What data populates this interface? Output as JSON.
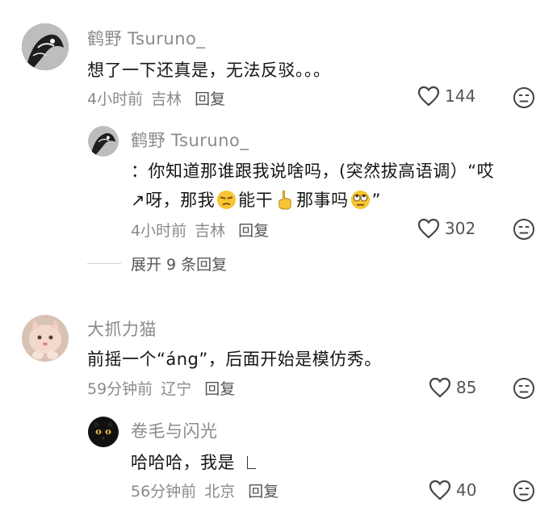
{
  "comments": [
    {
      "user": "鹤野 Tsuruno_",
      "text": "想了一下还真是，无法反驳。。。",
      "time": "4小时前",
      "location": "吉林",
      "reply_label": "回复",
      "likes": "144",
      "replies": [
        {
          "user": "鹤野 Tsuruno_",
          "text_line1": "：你知道那谁跟我说啥吗，(突然拔高语调）“哎",
          "text_line2_a": "↗呀，那我",
          "text_line2_b": "能干",
          "text_line2_c": "那事吗",
          "text_line2_d": "”",
          "time": "4小时前",
          "location": "吉林",
          "reply_label": "回复",
          "likes": "302"
        }
      ],
      "expand_label": "展开 9 条回复"
    },
    {
      "user": "大抓力猫",
      "text": "前摇一个“áng”，后面开始是模仿秀。",
      "time": "59分钟前",
      "location": "辽宁",
      "reply_label": "回复",
      "likes": "85",
      "replies": [
        {
          "user": "卷毛与闪光",
          "text": "哈哈哈，我是",
          "time": "56分钟前",
          "location": "北京",
          "reply_label": "回复",
          "likes": "40"
        }
      ]
    }
  ],
  "icons": {
    "like": "heart-outline-icon",
    "dislike": "frown-face-icon"
  }
}
